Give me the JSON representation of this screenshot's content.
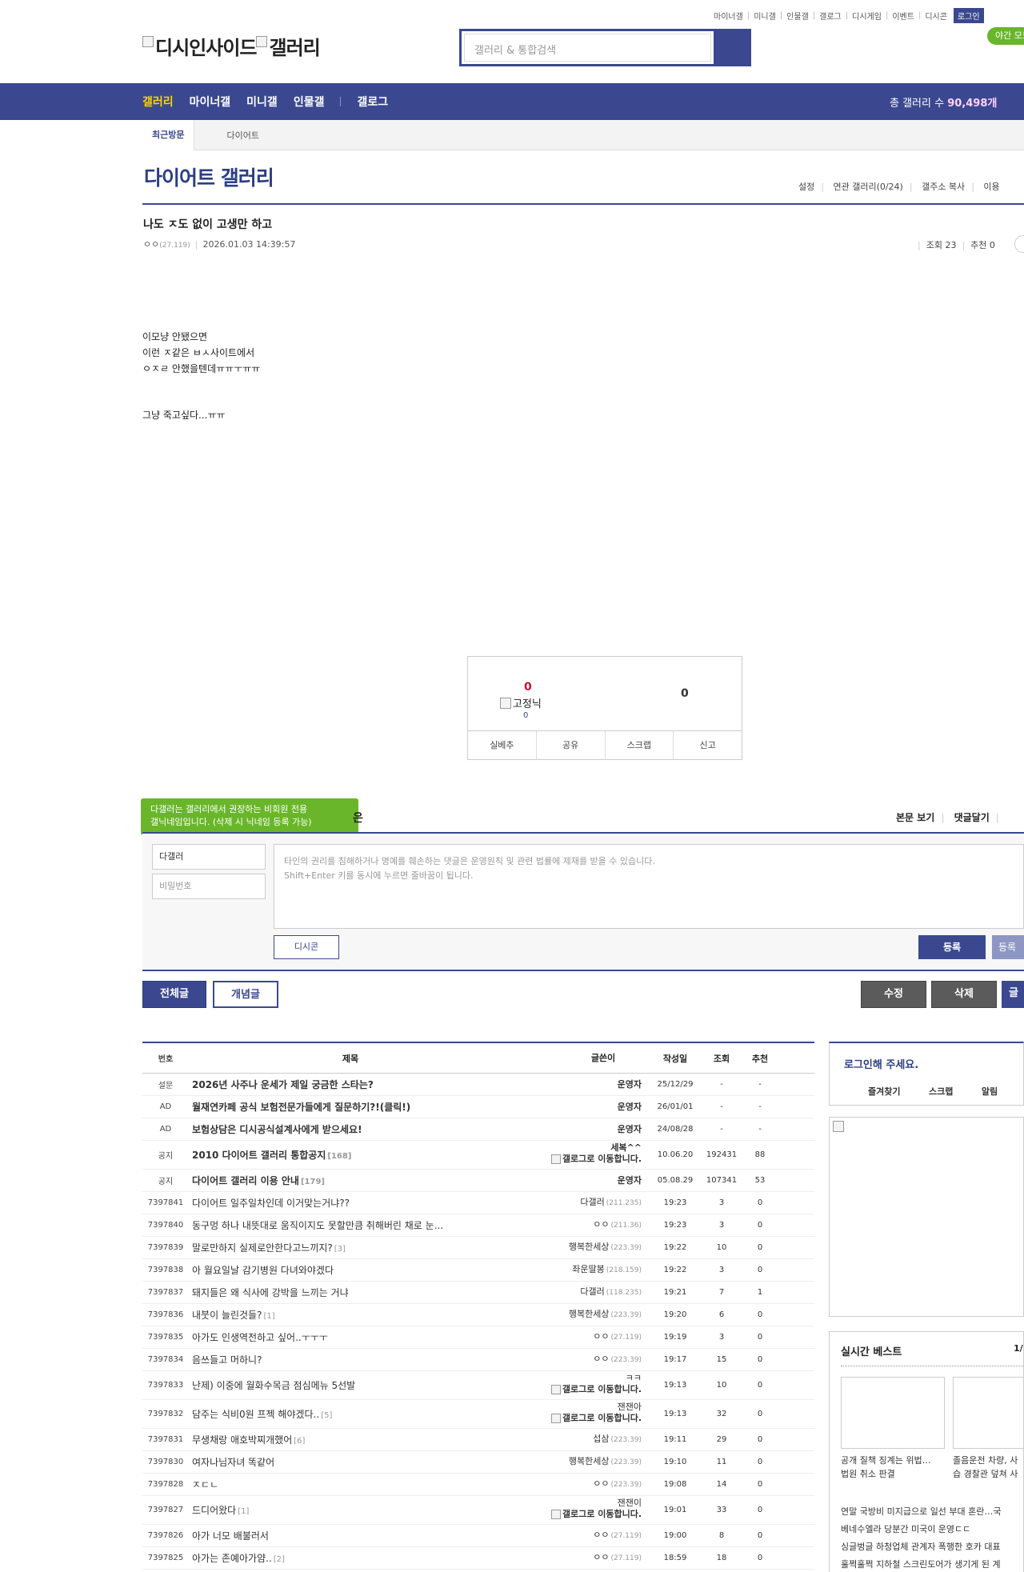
{
  "util_links": [
    "마이너갤",
    "미니갤",
    "인물갤",
    "갤로그",
    "디시게임",
    "이벤트",
    "디시콘"
  ],
  "login_label": "로그인",
  "night_mode_label": "야간 모드",
  "logo_alt_1": "디시인사이드",
  "logo_alt_2": "갤러리",
  "search_placeholder": "갤러리 & 통합검색",
  "gnb": {
    "items": [
      "갤러리",
      "마이너갤",
      "미니갤",
      "인물갤"
    ],
    "gallog": "갤로그",
    "total_label": "총 갤러리 수",
    "total_value": "90,498개"
  },
  "subnav": {
    "recent": "최근방문",
    "item": "다이어트"
  },
  "gallery_title": "다이어트 갤러리",
  "gallery_opts": [
    "설정",
    "연관 갤러리(0/24)",
    "갤주소 복사",
    "이용"
  ],
  "post": {
    "title": "나도 ㅈ도 없이 고생만 하고",
    "author": "ㅇㅇ",
    "author_ip": "(27.119)",
    "date": "2026.01.03 14:39:57",
    "views": "조회 23",
    "recs": "추천 0",
    "body": [
      "이모냥 안됐으면",
      "이런 ㅈ같은 ㅂㅅ사이트에서",
      "ㅇㅈㄹ 안했을텐데ㅠㅠㅜㅠㅠ",
      "그냥 죽고싶다...ㅠㅠ"
    ]
  },
  "recommend": {
    "up": "0",
    "fixed_alt": "고정닉",
    "fixed_count": "0",
    "down": "0",
    "buttons": [
      "실베추",
      "공유",
      "스크랩",
      "신고"
    ]
  },
  "comment": {
    "tip_line1": "다갤러는 갤러리에서 권장하는 비회원 전용",
    "tip_line2": "갤닉네임입니다. (삭제 시 닉네임 등록 가능)",
    "tip_tail": "은",
    "opts": [
      "본문 보기",
      "댓글달기"
    ],
    "nick": "다갤러",
    "pw_placeholder": "비밀번호",
    "textarea_line1": "타인의 권리를 침해하거나 명예를 훼손하는 댓글은 운영원칙 및 관련 법률에 제재를 받을 수 있습니다.",
    "textarea_line2": "Shift+Enter 키를 동시에 누르면 줄바꿈이 됩니다.",
    "dccon": "디시콘",
    "register": "등록",
    "register2": "등록"
  },
  "buttons": {
    "all": "전체글",
    "best": "개념글",
    "edit": "수정",
    "delete": "삭제",
    "write": "글"
  },
  "table": {
    "headers": [
      "번호",
      "제목",
      "글쓴이",
      "작성일",
      "조회",
      "추천"
    ],
    "rows": [
      {
        "num": "설문",
        "subject": "2026년 사주나 운세가 제일 궁금한 스타는?",
        "rc": "",
        "writer": "운영자",
        "ip": "",
        "date": "25/12/29",
        "views": "-",
        "recs": "-",
        "bold": true
      },
      {
        "num": "AD",
        "subject": "월재연카페 공식 보험전문가들에게 질문하기?!(클릭!)",
        "rc": "",
        "writer": "운영자",
        "ip": "",
        "date": "26/01/01",
        "views": "-",
        "recs": "-",
        "bold": true
      },
      {
        "num": "AD",
        "subject": "보험상담은 디시공식설계사에게 받으세요!",
        "rc": "",
        "writer": "운영자",
        "ip": "",
        "date": "24/08/28",
        "views": "-",
        "recs": "-",
        "bold": true
      },
      {
        "num": "공지",
        "subject": "2010 다이어트 갤러리 통합공지",
        "rc": "[168]",
        "writer": "세복^^",
        "ip": "",
        "gallog": true,
        "date": "10.06.20",
        "views": "192431",
        "recs": "88",
        "bold": true
      },
      {
        "num": "공지",
        "subject": "다이어트 갤러리 이용 안내",
        "rc": "[179]",
        "writer": "운영자",
        "ip": "",
        "date": "05.08.29",
        "views": "107341",
        "recs": "53",
        "bold": true
      },
      {
        "num": "7397841",
        "subject": "다이어트 일주일차인데 이거맞는거냐??",
        "rc": "",
        "writer": "다갤러",
        "ip": "(211.235)",
        "date": "19:23",
        "views": "3",
        "recs": "0"
      },
      {
        "num": "7397840",
        "subject": "동구멍 하나 내뜻대로 움직이지도 못할만큼 취해버린 채로 눈...",
        "rc": "",
        "writer": "ㅇㅇ",
        "ip": "(211.36)",
        "date": "19:23",
        "views": "3",
        "recs": "0"
      },
      {
        "num": "7397839",
        "subject": "말로만하지 실제로안한다고느끼지?",
        "rc": "[3]",
        "writer": "행복한세상",
        "ip": "(223.39)",
        "date": "19:22",
        "views": "10",
        "recs": "0"
      },
      {
        "num": "7397838",
        "subject": "아 월요일날 감기병원 다녀와야겠다",
        "rc": "",
        "writer": "좌운딸봉",
        "ip": "(218.159)",
        "date": "19:22",
        "views": "3",
        "recs": "0"
      },
      {
        "num": "7397837",
        "subject": "돼지들은 왜 식사에 강박을 느끼는 거냐",
        "rc": "",
        "writer": "다갤러",
        "ip": "(118.235)",
        "date": "19:21",
        "views": "7",
        "recs": "1"
      },
      {
        "num": "7397836",
        "subject": "내붓이 늘린것들?",
        "rc": "[1]",
        "writer": "행복한세상",
        "ip": "(223.39)",
        "date": "19:20",
        "views": "6",
        "recs": "0"
      },
      {
        "num": "7397835",
        "subject": "아가도 인생역전하고 싶어..ㅜㅜㅜ",
        "rc": "",
        "writer": "ㅇㅇ",
        "ip": "(27.119)",
        "date": "19:19",
        "views": "3",
        "recs": "0"
      },
      {
        "num": "7397834",
        "subject": "음쓰들고 머하니?",
        "rc": "",
        "writer": "ㅇㅇ",
        "ip": "(223.39)",
        "date": "19:17",
        "views": "15",
        "recs": "0"
      },
      {
        "num": "7397833",
        "subject": "난제) 이중에 월화수목금 점심메뉴 5선발",
        "rc": "",
        "writer": "ㅋㅋ",
        "ip": "",
        "gallog": true,
        "date": "19:13",
        "views": "10",
        "recs": "0"
      },
      {
        "num": "7397832",
        "subject": "담주는 식비0원 프젝 해야겠다..",
        "rc": "[5]",
        "writer": "잰잰아",
        "ip": "",
        "gallog": true,
        "date": "19:13",
        "views": "32",
        "recs": "0"
      },
      {
        "num": "7397831",
        "subject": "무생채랑 애호박찌개했어",
        "rc": "[6]",
        "writer": "섭삼",
        "ip": "(223.39)",
        "date": "19:11",
        "views": "29",
        "recs": "0"
      },
      {
        "num": "7397830",
        "subject": "여자나님자녀 똑같어",
        "rc": "",
        "writer": "행복한세상",
        "ip": "(223.39)",
        "date": "19:10",
        "views": "11",
        "recs": "0"
      },
      {
        "num": "7397828",
        "subject": "ㅈㄷㄴ",
        "rc": "",
        "writer": "ㅇㅇ",
        "ip": "(223.39)",
        "date": "19:08",
        "views": "14",
        "recs": "0"
      },
      {
        "num": "7397827",
        "subject": "드디어왔다",
        "rc": "[1]",
        "writer": "잰잰이",
        "ip": "",
        "gallog": true,
        "date": "19:01",
        "views": "33",
        "recs": "0"
      },
      {
        "num": "7397826",
        "subject": "아가 너모 배불러서",
        "rc": "",
        "writer": "ㅇㅇ",
        "ip": "(27.119)",
        "date": "19:00",
        "views": "8",
        "recs": "0"
      },
      {
        "num": "7397825",
        "subject": "아가는 존예아가얌..",
        "rc": "[2]",
        "writer": "ㅇㅇ",
        "ip": "(27.119)",
        "date": "18:59",
        "views": "18",
        "recs": "0"
      }
    ]
  },
  "gallog_alt": "갤로그로 이동합니다.",
  "side": {
    "login_title": "로그인해 주세요.",
    "login_links": [
      "즐겨찾기",
      "스크랩",
      "알림"
    ],
    "best_title": "실시간 베스트",
    "best_page": "1/",
    "best_caps": [
      "공개 질책 징계는 위법…",
      "법원 취소 판결",
      "졸음운전 차량, 사",
      "습 경찰관 덮쳐 사"
    ],
    "best_list": [
      "연말 국방비 미지급으로 일선 부대 혼란…국",
      "베네수엘라 당분간 미국이 운영ㄷㄷ",
      "싱글벙글 하청업체 관계자 폭행한 호카 대표",
      "훌쩍훌쩍 지하철 스크린도어가 생기게 된 계"
    ]
  }
}
